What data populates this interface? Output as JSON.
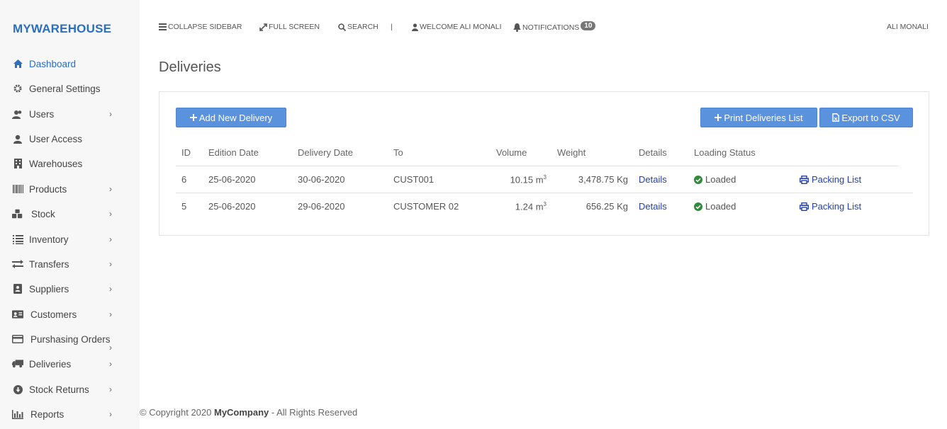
{
  "brand": "MYWAREHOUSE",
  "sidebar": {
    "items": [
      {
        "label": "Dashboard",
        "icon": "home-icon",
        "active": true,
        "has_children": false
      },
      {
        "label": "General Settings",
        "icon": "gear-icon",
        "has_children": false
      },
      {
        "label": "Users",
        "icon": "users-icon",
        "has_children": true
      },
      {
        "label": "User Access",
        "icon": "user-icon",
        "has_children": false
      },
      {
        "label": "Warehouses",
        "icon": "building-icon",
        "has_children": false
      },
      {
        "label": "Products",
        "icon": "barcode-icon",
        "has_children": true
      },
      {
        "label": "Stock",
        "icon": "cubes-icon",
        "has_children": true
      },
      {
        "label": "Inventory",
        "icon": "list-icon",
        "has_children": true
      },
      {
        "label": "Transfers",
        "icon": "exchange-icon",
        "has_children": true
      },
      {
        "label": "Suppliers",
        "icon": "address-book-icon",
        "has_children": true
      },
      {
        "label": "Customers",
        "icon": "id-card-icon",
        "has_children": true
      },
      {
        "label": "Purshasing Orders",
        "icon": "credit-card-icon",
        "has_children": true
      },
      {
        "label": "Deliveries",
        "icon": "truck-icon",
        "has_children": true
      },
      {
        "label": "Stock Returns",
        "icon": "arrow-circle-down-icon",
        "has_children": true
      },
      {
        "label": "Reports",
        "icon": "bar-chart-icon",
        "has_children": true
      }
    ]
  },
  "topbar": {
    "collapse": "COLLAPSE SIDEBAR",
    "fullscreen": "FULL SCREEN",
    "search": "SEARCH",
    "separator": "|",
    "welcome": "WELCOME ALI MONALI",
    "notifications": "NOTIFICATIONS",
    "notifications_count": "10",
    "user": "ALI MONALI"
  },
  "page": {
    "title": "Deliveries",
    "add_button": "Add New Delivery",
    "print_button": "Print Deliveries List",
    "export_button": "Export to CSV"
  },
  "table": {
    "headers": [
      "ID",
      "Edition Date",
      "Delivery Date",
      "To",
      "Volume",
      "Weight",
      "Details",
      "Loading Status"
    ],
    "rows": [
      {
        "id": "6",
        "edition_date": "25-06-2020",
        "delivery_date": "30-06-2020",
        "to": "CUST001",
        "volume": "10.15 m",
        "volume_unit_sup": "3",
        "weight": "3,478.75 Kg",
        "details": "Details",
        "status": "Loaded",
        "packing": "Packing List"
      },
      {
        "id": "5",
        "edition_date": "25-06-2020",
        "delivery_date": "29-06-2020",
        "to": "CUSTOMER 02",
        "volume": "1.24 m",
        "volume_unit_sup": "3",
        "weight": "656.25 Kg",
        "details": "Details",
        "status": "Loaded",
        "packing": "Packing List"
      }
    ]
  },
  "footer": {
    "prefix": "© Copyright 2020 ",
    "company": "MyCompany",
    "suffix": " - All Rights Reserved"
  },
  "colors": {
    "brand": "#2a6fc0",
    "button": "#5b92de",
    "link": "#2440a8",
    "status_ok": "#2e8b3a"
  }
}
